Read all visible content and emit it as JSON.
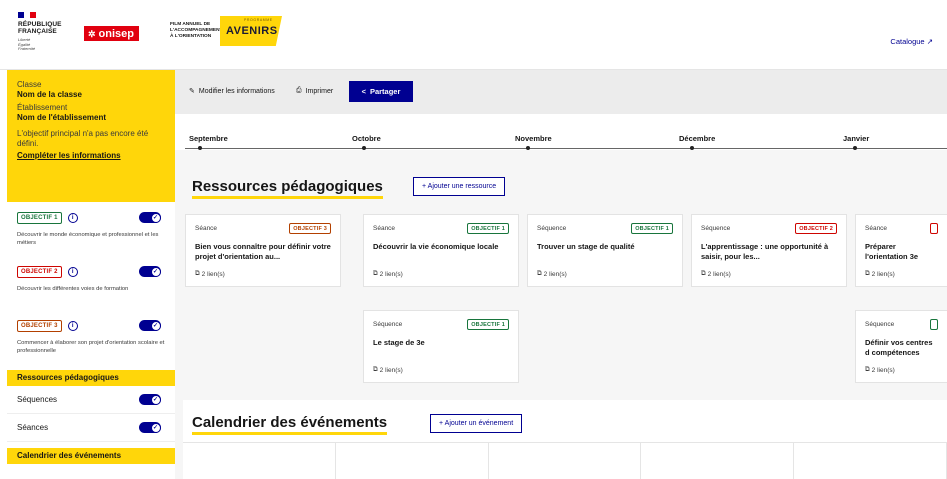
{
  "header": {
    "republic_lines": [
      "RÉPUBLIQUE",
      "FRANÇAISE"
    ],
    "motto_lines": [
      "Liberté",
      "Égalité",
      "Fraternité"
    ],
    "brand": "onisep",
    "film_lines": [
      "FILM ANNUEL DE",
      "L'ACCOMPAGNEMENT",
      "À L'ORIENTATION"
    ],
    "programme_label": "PROGRAMME",
    "avenirs": "AVENIRS",
    "catalogue_link": "Catalogue"
  },
  "sidebar": {
    "classe_label": "Classe",
    "classe_value": "Nom de la classe",
    "etab_label": "Établissement",
    "etab_value": "Nom de l'établissement",
    "objectif_note": "L'objectif principal n'a pas encore été défini.",
    "complete_link": "Compléter les informations",
    "objectives": [
      {
        "badge": "OBJECTIF 1",
        "desc": "Découvrir le monde économique et professionnel et les métiers"
      },
      {
        "badge": "OBJECTIF 2",
        "desc": "Découvrir les différentes voies de formation"
      },
      {
        "badge": "OBJECTIF 3",
        "desc": "Commencer à élaborer son projet d'orientation scolaire et professionnelle"
      }
    ],
    "ressources_section": "Ressources pédagogiques",
    "items": [
      {
        "label": "Séquences"
      },
      {
        "label": "Séances"
      }
    ],
    "calendar_section": "Calendrier des événements"
  },
  "toolbar": {
    "modify": "Modifier les informations",
    "print": "Imprimer",
    "share": "Partager"
  },
  "timeline": {
    "months": [
      "Septembre",
      "Octobre",
      "Novembre",
      "Décembre",
      "Janvier"
    ]
  },
  "resources": {
    "title": "Ressources pédagogiques",
    "add_button": "+ Ajouter une ressource",
    "cards": [
      {
        "type": "Séance",
        "badge": "OBJECTIF 3",
        "title": "Bien vous connaître pour définir votre projet d'orientation au...",
        "links": "2 lien(s)"
      },
      {
        "type": "Séance",
        "badge": "OBJECTIF 1",
        "title": "Découvrir la vie économique locale",
        "links": "2 lien(s)"
      },
      {
        "type": "Séquence",
        "badge": "OBJECTIF 1",
        "title": "Trouver un stage de qualité",
        "links": "2 lien(s)"
      },
      {
        "type": "Séquence",
        "badge": "OBJECTIF 2",
        "title": "L'apprentissage : une opportunité à saisir, pour les...",
        "links": "2 lien(s)"
      },
      {
        "type": "Séance",
        "badge": "",
        "title": "Préparer l'orientation 3e",
        "links": "2 lien(s)"
      },
      {
        "type": "Séquence",
        "badge": "OBJECTIF 1",
        "title": "Le stage de 3e",
        "links": "2 lien(s)"
      },
      {
        "type": "Séquence",
        "badge": "",
        "title": "Définir vos centres d compétences",
        "links": "2 lien(s)"
      }
    ]
  },
  "calendar": {
    "title": "Calendrier des événements",
    "add_button": "+ Ajouter un événement"
  },
  "colors": {
    "blue": "#000091",
    "yellow": "#ffd60a",
    "obj1": "#18753c",
    "obj2": "#ce0500",
    "obj3": "#b34000"
  }
}
